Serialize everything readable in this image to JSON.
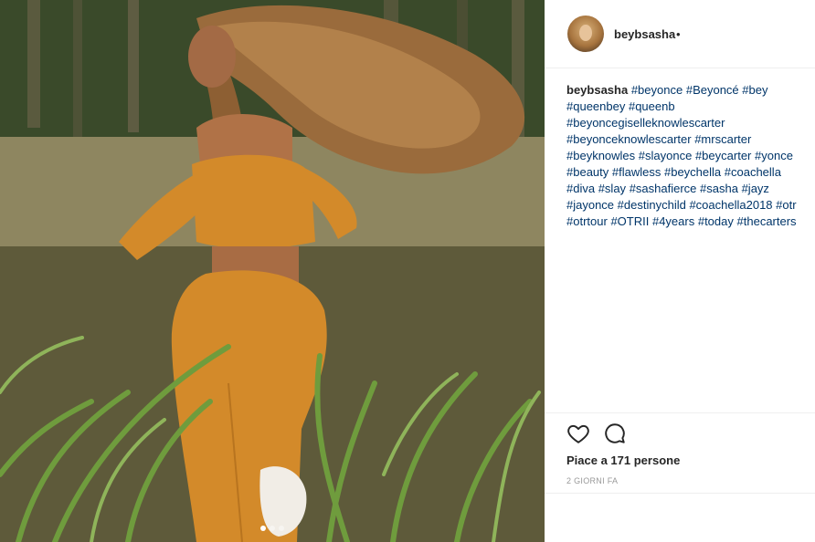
{
  "post": {
    "username": "beybsasha",
    "follow_separator": "•",
    "avatar_icon": "profile-avatar",
    "caption_author": "beybsasha",
    "hashtags": [
      "#beyonce",
      "#Beyoncé",
      "#bey",
      "#queenbey",
      "#queenb",
      "#beyoncegiselleknowlescarter",
      "#beyonceknowlescarter",
      "#mrscarter",
      "#beyknowles",
      "#slayonce",
      "#beycarter",
      "#yonce",
      "#beauty",
      "#flawless",
      "#beychella",
      "#coachella",
      "#diva",
      "#slay",
      "#sashafierce",
      "#sasha",
      "#jayz",
      "#jayonce",
      "#destinychild",
      "#coachella2018",
      "#otr",
      "#otrtour",
      "#OTRII",
      "#4years",
      "#today",
      "#thecarters"
    ],
    "likes_text": "Piace a 171 persone",
    "time_text": "2 GIORNI FA",
    "like_icon": "heart-outline",
    "comment_icon": "speech-bubble",
    "carousel": {
      "count": 3,
      "active_index": 0
    }
  },
  "colors": {
    "hashtag": "#003569",
    "text": "#262626",
    "muted": "#999999",
    "divider": "#efefef",
    "outfit": "#d38a2a"
  }
}
